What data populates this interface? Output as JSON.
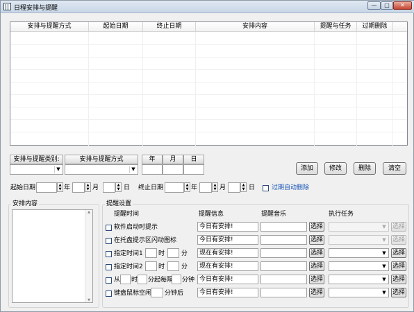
{
  "window": {
    "title": "日程安排与提醒",
    "min": "—",
    "max": "□",
    "close": "✕"
  },
  "table": {
    "columns": [
      "安排与提醒方式",
      "起始日期",
      "终止日期",
      "安排内容",
      "提醒与任务",
      "过期删除"
    ]
  },
  "form": {
    "type_label": "安排与提醒类别:",
    "mode_label": "安排与提醒方式",
    "year_label": "年",
    "month_label": "月",
    "day_label": "日",
    "start_date_label": "起始日期",
    "end_date_label": "终止日期",
    "auto_delete_label": "过期自动删除",
    "ymd_year": "年",
    "ymd_month": "月",
    "ymd_day": "日"
  },
  "buttons": {
    "add": "添加",
    "modify": "修改",
    "delete": "删除",
    "clear": "清空"
  },
  "content_group": {
    "title": "安排内容"
  },
  "reminder": {
    "title": "提醒设置",
    "col_time": "提醒时间",
    "col_info": "提醒信息",
    "col_music": "提醒音乐",
    "col_task": "执行任务",
    "rows": [
      {
        "label": "软件启动时提示",
        "info": "今日有安排!",
        "choose": "选择",
        "task_choose": "选择"
      },
      {
        "label": "在托盘提示区闪动图标",
        "info": "今日有安排!",
        "choose": "选择",
        "task_choose": "选择"
      },
      {
        "label": "指定时间1",
        "hour": "时",
        "minute": "分",
        "info": "现在有安排!",
        "choose": "选择",
        "task_choose": "选择"
      },
      {
        "label": "指定时间2",
        "hour": "时",
        "minute": "分",
        "info": "现在有安排!",
        "choose": "选择",
        "task_choose": "选择"
      },
      {
        "label": "从",
        "hour": "时",
        "every": "分起每隔",
        "minute": "分钟",
        "info": "今日有安排!",
        "choose": "选择",
        "task_choose": "选择"
      },
      {
        "label": "键盘鼠标空闲",
        "after": "分钟后",
        "info": "今日有安排!",
        "choose": "选择",
        "task_choose": "选择"
      }
    ]
  }
}
